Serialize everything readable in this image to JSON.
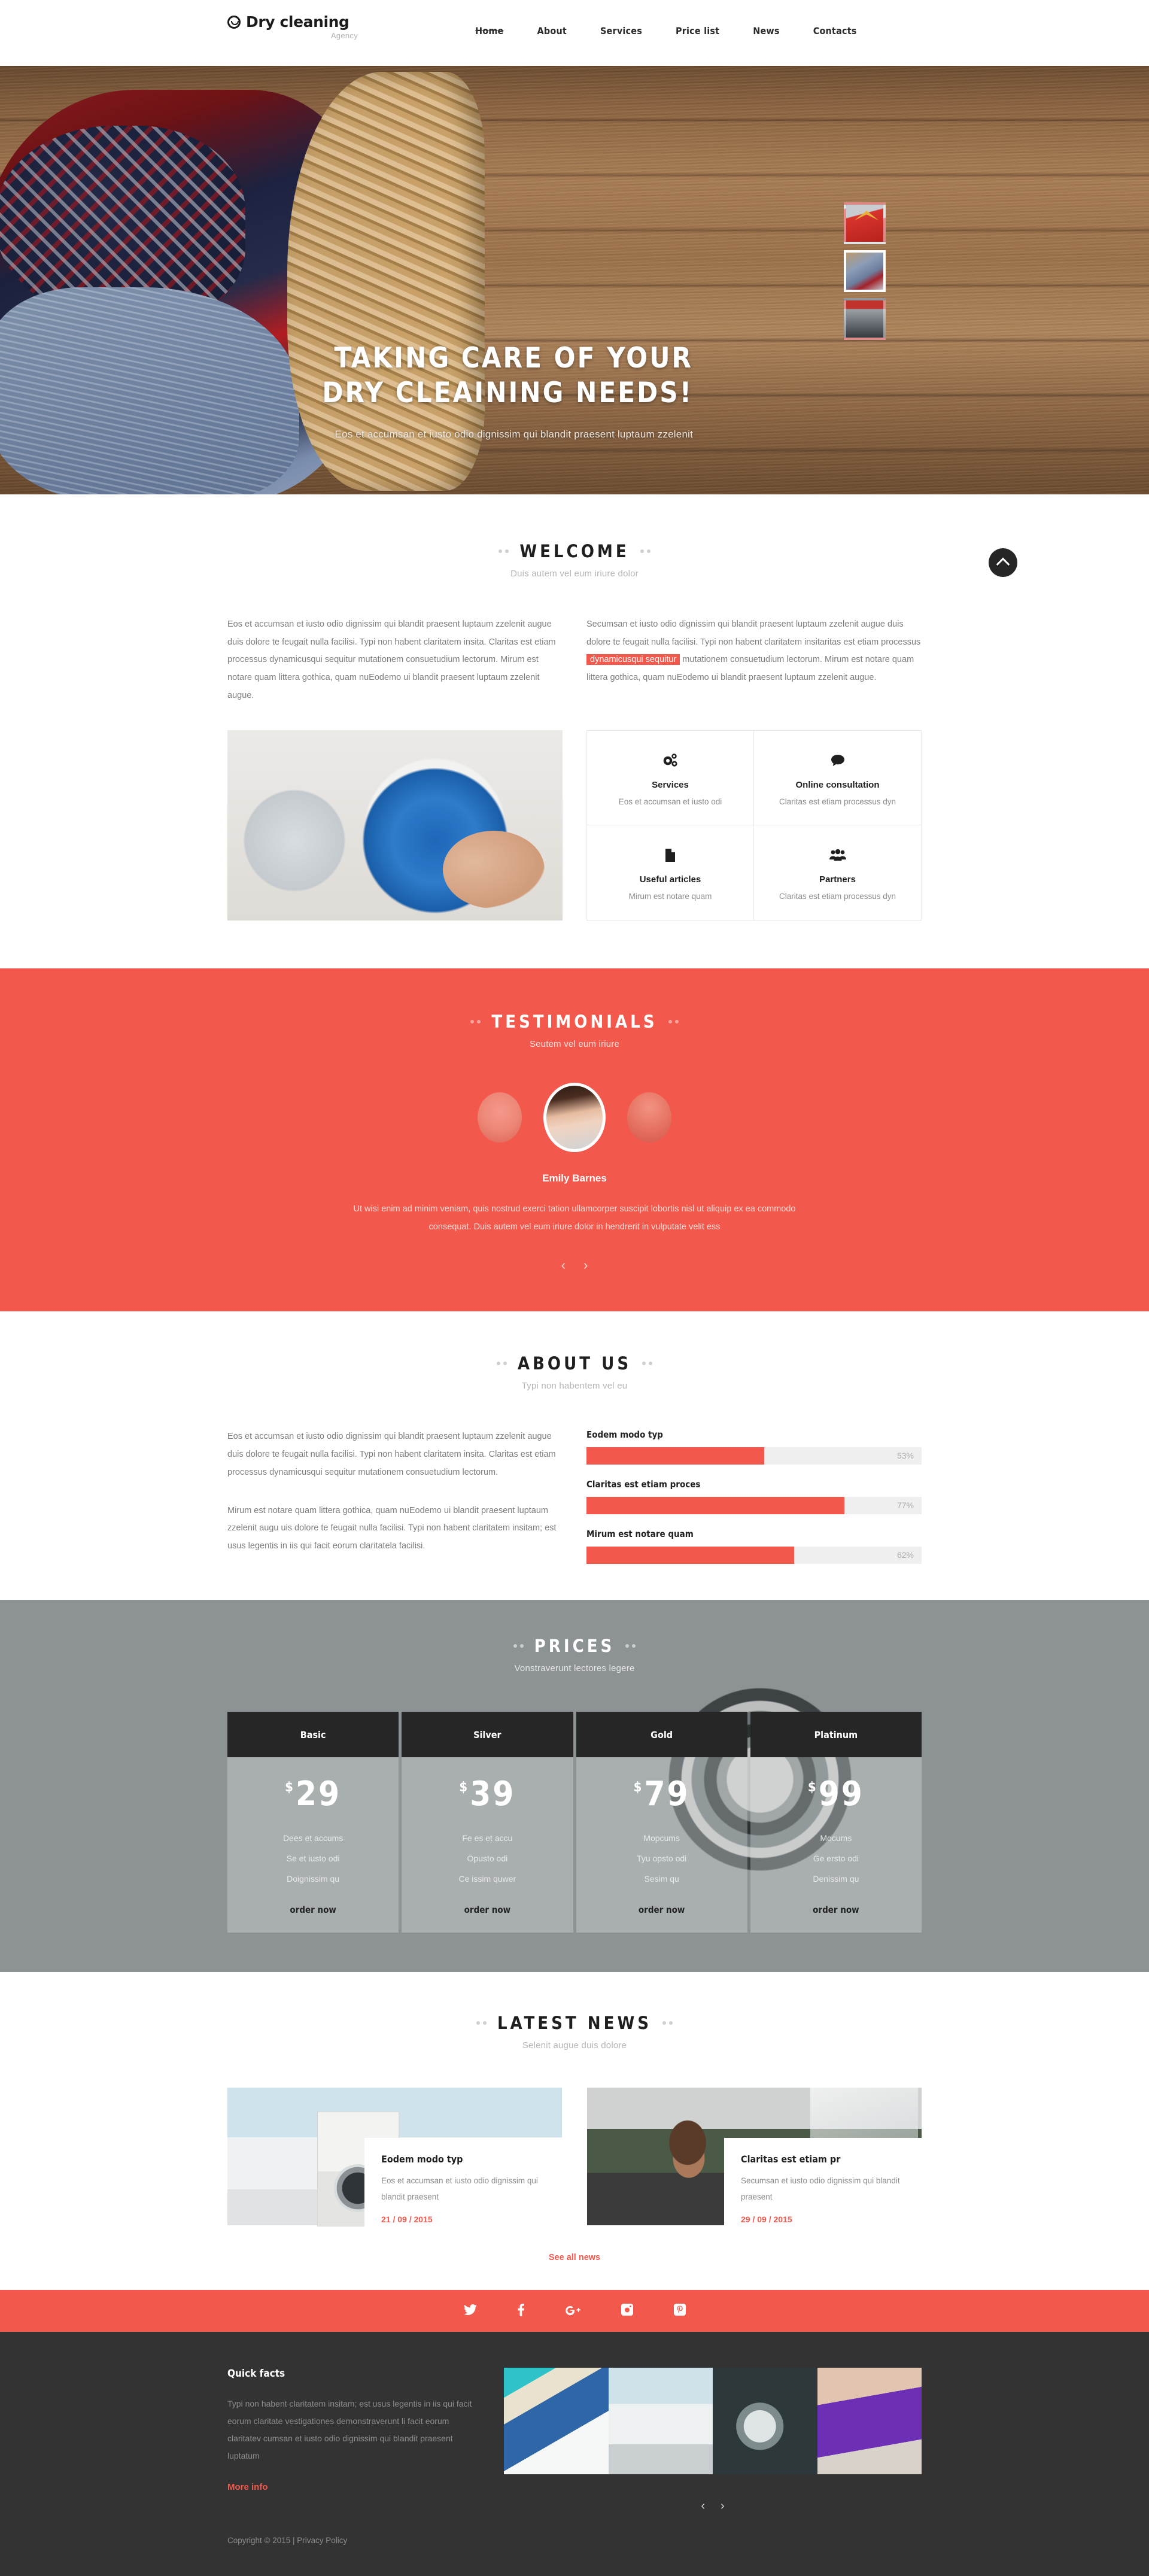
{
  "brand": {
    "name": "Dry cleaning",
    "tagline": "Agency",
    "accent": "#f2584c",
    "dark": "#262626"
  },
  "nav": {
    "items": [
      {
        "label": "Home",
        "active": true
      },
      {
        "label": "About",
        "active": false
      },
      {
        "label": "Services",
        "active": false
      },
      {
        "label": "Price list",
        "active": false
      },
      {
        "label": "News",
        "active": false
      },
      {
        "label": "Contacts",
        "active": false
      }
    ]
  },
  "hero": {
    "title_line1": "TAKING CARE OF YOUR",
    "title_line2": "DRY CLEAINING NEEDS!",
    "subtitle": "Eos et accumsan et iusto odio dignissim qui blandit praesent luptaum zzelenit",
    "thumbs": [
      {
        "name": "red-shirt-thumb",
        "selected": false
      },
      {
        "name": "laundry-basket-thumb",
        "selected": true
      },
      {
        "name": "washing-machines-thumb",
        "selected": false
      }
    ]
  },
  "scroll_top": {
    "icon": "chevron-up-icon"
  },
  "welcome": {
    "title": "WELCOME",
    "subtitle": "Duis autem vel eum iriure dolor",
    "left_text": "Eos et accumsan et iusto odio dignissim qui blandit praesent luptaum zzelenit augue duis dolore te feugait nulla facilisi. Typi non habent claritatem insita. Claritas est etiam processus dynamicusqui sequitur mutationem consuetudium lectorum. Mirum est notare quam littera gothica, quam nuEodemo ui blandit praesent luptaum zzelenit augue.",
    "right_text_before": "Secumsan et iusto odio dignissim qui blandit praesent luptaum zzelenit augue duis dolore te feugait nulla facilisi. Typi non habent claritatem insitaritas est etiam processus ",
    "right_highlight": "dynamicusqui sequitur",
    "right_text_after": " mutationem consuetudium lectorum. Mirum est notare quam littera gothica, quam nuEodemo ui blandit praesent luptaum zzelenit augue.",
    "features": [
      {
        "icon": "gears-icon",
        "glyph": "⚙",
        "title": "Services",
        "desc": "Eos et accumsan et iusto odi"
      },
      {
        "icon": "speech-bubble-icon",
        "glyph": "💬",
        "title": "Online consultation",
        "desc": "Claritas est etiam processus dyn"
      },
      {
        "icon": "document-icon",
        "glyph": "🗎",
        "title": "Useful articles",
        "desc": "Mirum est notare quam"
      },
      {
        "icon": "people-group-icon",
        "glyph": "👥",
        "title": "Partners",
        "desc": "Claritas est etiam processus dyn"
      }
    ]
  },
  "testimonials": {
    "title": "TESTIMONIALS",
    "subtitle": "Seutem vel eum iriure",
    "author": "Emily Barnes",
    "quote": "Ut wisi enim ad minim veniam, quis nostrud exerci tation ullamcorper suscipit lobortis nisl ut aliquip ex ea commodo consequat. Duis autem vel eum iriure dolor in hendrerit in vulputate velit ess",
    "prev": "‹",
    "next": "›"
  },
  "about": {
    "title": "ABOUT US",
    "subtitle": "Typi non habentem vel eu",
    "paragraph1": "Eos et accumsan et iusto odio dignissim qui blandit praesent luptaum zzelenit augue duis dolore te feugait nulla facilisi. Typi non habent claritatem insita. Claritas est etiam processus dynamicusqui sequitur mutationem consuetudium lectorum.",
    "paragraph2": "Mirum est notare quam littera gothica, quam nuEodemo ui blandit praesent luptaum zzelenit augu uis dolore te feugait nulla facilisi. Typi non habent claritatem insitam; est usus legentis in iis qui facit eorum claritatela facilisi."
  },
  "chart_data": {
    "type": "bar",
    "title": "",
    "orientation": "horizontal",
    "categories": [
      "Eodem modo typ",
      "Claritas est etiam proces",
      "Mirum est notare quam"
    ],
    "values": [
      53,
      77,
      62
    ],
    "value_labels": [
      "53%",
      "77%",
      "62%"
    ],
    "xlim": [
      0,
      100
    ],
    "xlabel": "",
    "ylabel": "",
    "grid": false,
    "legend": false,
    "bar_color": "#f2584c",
    "track_color": "#efefef"
  },
  "prices": {
    "title": "PRICES",
    "subtitle": "Vonstraverunt lectores legere",
    "plans": [
      {
        "name": "Basic",
        "currency": "$",
        "amount": "29",
        "features": [
          "Dees et accums",
          "Se et iusto odi",
          "Doignissim qu"
        ],
        "cta": "order now"
      },
      {
        "name": "Silver",
        "currency": "$",
        "amount": "39",
        "features": [
          "Fe es et accu",
          "Opusto odi",
          "Ce issim quwer"
        ],
        "cta": "order now"
      },
      {
        "name": "Gold",
        "currency": "$",
        "amount": "79",
        "features": [
          "Mopcums",
          "Tyu opsto odi",
          "Sesim qu"
        ],
        "cta": "order now"
      },
      {
        "name": "Platinum",
        "currency": "$",
        "amount": "99",
        "features": [
          "Mocums",
          "Ge ersto odi",
          "Denissim qu"
        ],
        "cta": "order now"
      }
    ]
  },
  "news": {
    "title": "LATEST NEWS",
    "subtitle": "Selenit augue duis dolore",
    "items": [
      {
        "title": "Eodem modo typ",
        "text": "Eos et accumsan et iusto odio dignissim qui blandit praesent",
        "date": "21 / 09 / 2015"
      },
      {
        "title": "Claritas est etiam pr",
        "text": "Secumsan et iusto odio dignissim qui blandit praesent",
        "date": "29 / 09 / 2015"
      }
    ],
    "see_all": "See all news"
  },
  "social": [
    {
      "icon": "twitter-icon",
      "glyph": "🐦"
    },
    {
      "icon": "facebook-icon",
      "glyph": "f"
    },
    {
      "icon": "google-plus-icon",
      "glyph": "g⁺"
    },
    {
      "icon": "instagram-icon",
      "glyph": "▣"
    },
    {
      "icon": "pinterest-icon",
      "glyph": "ⓟ"
    }
  ],
  "footer": {
    "heading": "Quick facts",
    "text": "Typi non habent claritatem insitam; est usus legentis in iis qui facit eorum claritate vestigationes demonstraverunt li facit eorum claritatev cumsan et iusto odio dignissim qui blandit praesent luptatum",
    "more_info": "More info",
    "copyright": "Copyright © 2015 |",
    "privacy": "Privacy Policy",
    "gallery": [
      {
        "name": "gallery-clothes-worker"
      },
      {
        "name": "gallery-laundry-room"
      },
      {
        "name": "gallery-washing-machines"
      },
      {
        "name": "gallery-smiling-woman"
      }
    ],
    "prev": "‹",
    "next": "›"
  }
}
